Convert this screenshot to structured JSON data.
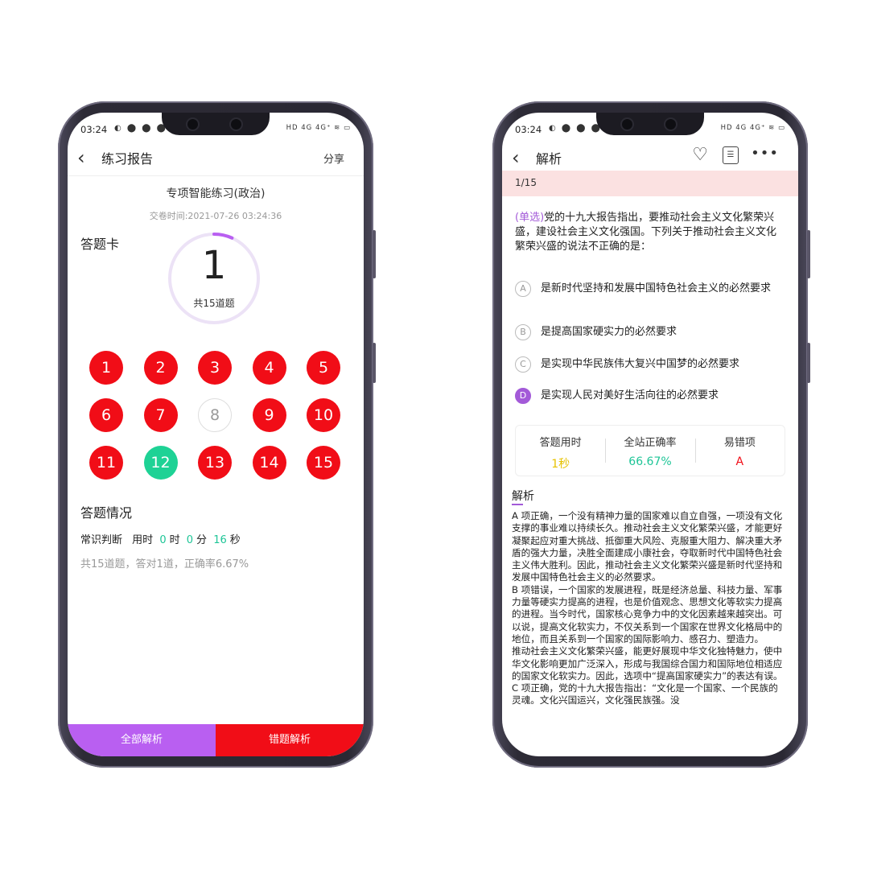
{
  "left": {
    "status": {
      "time": "03:24",
      "icons_left": "◐ ⬤ ⬤ ⬤ ♪ ⬛",
      "icons_right": "HD 4G 4G⁺ ≋ ▭"
    },
    "header": {
      "title": "练习报告",
      "share": "分享"
    },
    "exam_title": "专项智能练习(政治)",
    "submit_time": "交卷时间:2021-07-26 03:24:36",
    "card_label": "答题卡",
    "ring": {
      "count": "1",
      "total_label": "共15道题",
      "progress": 0.0667,
      "accent": "#b95ff1"
    },
    "questions": [
      {
        "n": "1",
        "state": "wrong"
      },
      {
        "n": "2",
        "state": "wrong"
      },
      {
        "n": "3",
        "state": "wrong"
      },
      {
        "n": "4",
        "state": "wrong"
      },
      {
        "n": "5",
        "state": "wrong"
      },
      {
        "n": "6",
        "state": "wrong"
      },
      {
        "n": "7",
        "state": "wrong"
      },
      {
        "n": "8",
        "state": "unanswered"
      },
      {
        "n": "9",
        "state": "wrong"
      },
      {
        "n": "10",
        "state": "wrong"
      },
      {
        "n": "11",
        "state": "wrong"
      },
      {
        "n": "12",
        "state": "correct"
      },
      {
        "n": "13",
        "state": "wrong"
      },
      {
        "n": "14",
        "state": "wrong"
      },
      {
        "n": "15",
        "state": "wrong"
      }
    ],
    "situation": {
      "title": "答题情况",
      "category": "常识判断",
      "used_label": "用时",
      "hours": "0",
      "hours_unit": "时",
      "minutes": "0",
      "minutes_unit": "分",
      "seconds": "16",
      "seconds_unit": "秒",
      "summary": "共15道题，答对1道，正确率6.67%"
    },
    "bottom": {
      "all": "全部解析",
      "wrong": "错题解析"
    },
    "colors": {
      "wrong": "#f10d17",
      "correct": "#1ed295",
      "all_btn": "#b95ff1"
    }
  },
  "right": {
    "status": {
      "time": "03:24",
      "icons_left": "◐ ⬤ ⬤ ⬤ ♪ ⬛",
      "icons_right": "HD 4G 4G⁺ ≋ ▭"
    },
    "header": {
      "title": "解析"
    },
    "progress": "1/15",
    "question": {
      "tag": "(单选)",
      "text": "党的十九大报告指出，要推动社会主义文化繁荣兴盛，建设社会主义文化强国。下列关于推动社会主义文化繁荣兴盛的说法不正确的是："
    },
    "options": [
      {
        "letter": "A",
        "text": "是新时代坚持和发展中国特色社会主义的必然要求",
        "selected": false
      },
      {
        "letter": "B",
        "text": "是提高国家硬实力的必然要求",
        "selected": false
      },
      {
        "letter": "C",
        "text": "是实现中华民族伟大复兴中国梦的必然要求",
        "selected": false
      },
      {
        "letter": "D",
        "text": "是实现人民对美好生活向往的必然要求",
        "selected": true
      }
    ],
    "stats": {
      "time_label": "答题用时",
      "time_value": "1秒",
      "rate_label": "全站正确率",
      "rate_value": "66.67%",
      "err_label": "易错项",
      "err_value": "A",
      "colors": {
        "time": "#e6c200",
        "rate": "#1ec597",
        "err": "#f10d17"
      }
    },
    "analysis_title": "解析",
    "analysis_text": "A 项正确，一个没有精神力量的国家难以自立自强，一项没有文化支撑的事业难以持续长久。推动社会主义文化繁荣兴盛，才能更好凝聚起应对重大挑战、抵御重大风险、克服重大阻力、解决重大矛盾的强大力量，决胜全面建成小康社会，夺取新时代中国特色社会主义伟大胜利。因此，推动社会主义文化繁荣兴盛是新时代坚持和发展中国特色社会主义的必然要求。\nB 项错误，一个国家的发展进程，既是经济总量、科技力量、军事力量等硬实力提高的进程，也是价值观念、思想文化等软实力提高的进程。当今时代，国家核心竞争力中的文化因素越来越突出。可以说，提高文化软实力，不仅关系到一个国家在世界文化格局中的地位，而且关系到一个国家的国际影响力、感召力、塑造力。\n推动社会主义文化繁荣兴盛，能更好展现中华文化独特魅力，使中华文化影响更加广泛深入，形成与我国综合国力和国际地位相适应的国家文化软实力。因此，选项中“提高国家硬实力”的表达有误。\nC 项正确，党的十九大报告指出：“文化是一个国家、一个民族的灵魂。文化兴国运兴，文化强民族强。没"
  }
}
